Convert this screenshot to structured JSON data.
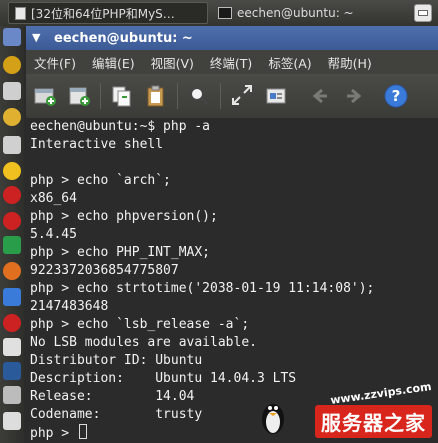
{
  "taskbar": {
    "buttons": [
      {
        "label": "[32位和64位PHP和MyS…"
      },
      {
        "label": "eechen@ubuntu: ~"
      }
    ]
  },
  "window": {
    "title": "eechen@ubuntu: ~",
    "menu": [
      "文件(F)",
      "编辑(E)",
      "视图(V)",
      "终端(T)",
      "标签(A)",
      "帮助(H)"
    ]
  },
  "toolbar": {
    "icons": [
      "new-tab-icon",
      "new-window-icon",
      "copy-icon",
      "paste-icon",
      "search-icon",
      "fullscreen-icon",
      "preferences-icon",
      "back-icon",
      "forward-icon",
      "help-icon"
    ],
    "help_label": "?"
  },
  "terminal": {
    "lines": [
      "eechen@ubuntu:~$ php -a",
      "Interactive shell",
      "",
      "php > echo `arch`;",
      "x86_64",
      "php > echo phpversion();",
      "5.4.45",
      "php > echo PHP_INT_MAX;",
      "9223372036854775807",
      "php > echo strtotime('2038-01-19 11:14:08');",
      "2147483648",
      "php > echo `lsb_release -a`;",
      "No LSB modules are available.",
      "Distributor ID: Ubuntu",
      "Description:    Ubuntu 14.04.3 LTS",
      "Release:        14.04",
      "Codename:       trusty",
      "php > "
    ]
  },
  "watermark": {
    "url": "www.zzvips.com",
    "brand": "服务器之家"
  },
  "colors": {
    "titlebar": "#3f5f9e",
    "terminal_bg": "#2b2b2b",
    "terminal_fg": "#f2f2f2",
    "brand_red": "#d9261c"
  }
}
